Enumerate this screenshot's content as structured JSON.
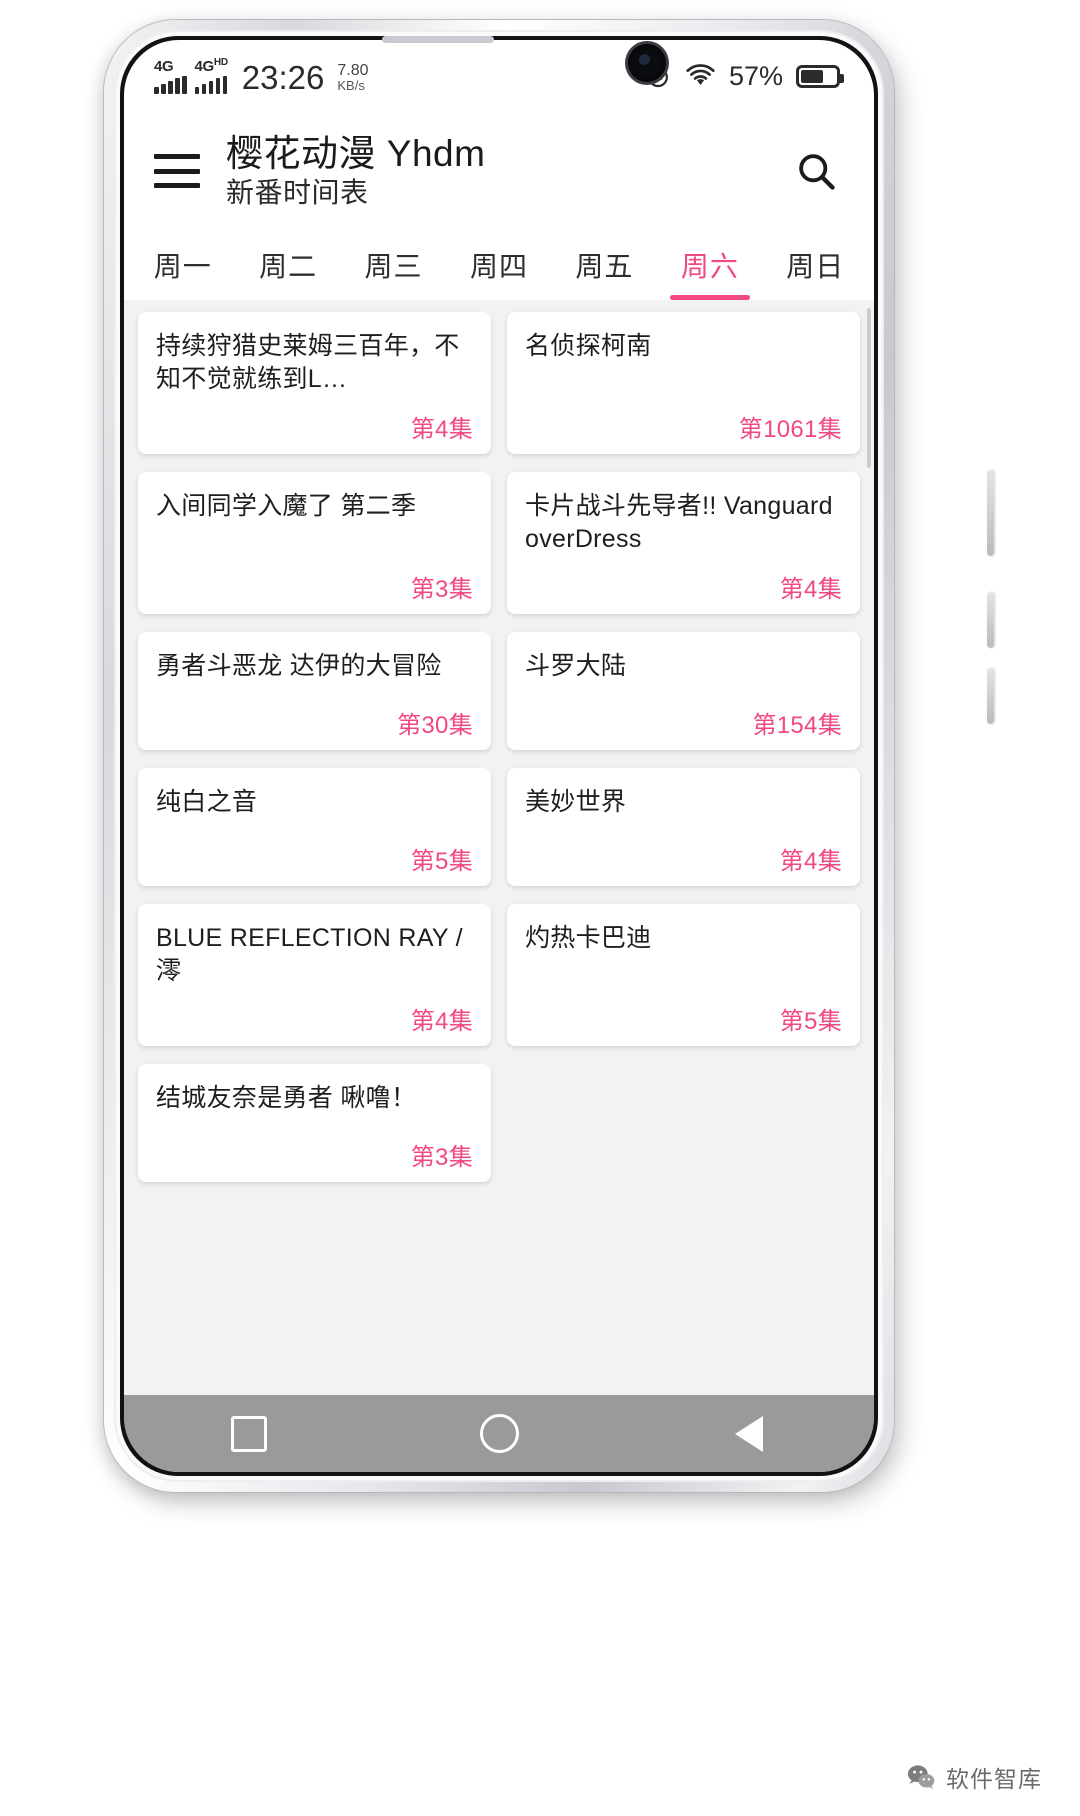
{
  "statusbar": {
    "network_label_1": "4G",
    "network_label_2": "4G",
    "network_label_2_sup": "HD",
    "time": "23:26",
    "speed_value": "7.80",
    "speed_unit": "KB/s",
    "alarm_icon": "alarm-clock-icon",
    "wifi_icon": "wifi-icon",
    "battery_percent": "57%",
    "battery_icon": "battery-icon"
  },
  "appbar": {
    "menu_icon": "hamburger-menu-icon",
    "title": "樱花动漫 Yhdm",
    "subtitle": "新番时间表",
    "search_icon": "search-icon"
  },
  "tabs": {
    "items": [
      {
        "label": "周一",
        "active": false
      },
      {
        "label": "周二",
        "active": false
      },
      {
        "label": "周三",
        "active": false
      },
      {
        "label": "周四",
        "active": false
      },
      {
        "label": "周五",
        "active": false
      },
      {
        "label": "周六",
        "active": true
      },
      {
        "label": "周日",
        "active": false
      }
    ],
    "active_color": "#f1497f"
  },
  "schedule": {
    "cards": [
      {
        "title": "持续狩猎史莱姆三百年，不知不觉就练到L…",
        "episode": "第4集"
      },
      {
        "title": "名侦探柯南",
        "episode": "第1061集"
      },
      {
        "title": "入间同学入魔了 第二季",
        "episode": "第3集"
      },
      {
        "title": "卡片战斗先导者!! Vanguard overDress",
        "episode": "第4集"
      },
      {
        "title": "勇者斗恶龙 达伊的大冒险",
        "episode": "第30集"
      },
      {
        "title": "斗罗大陆",
        "episode": "第154集"
      },
      {
        "title": "纯白之音",
        "episode": "第5集"
      },
      {
        "title": "美妙世界",
        "episode": "第4集"
      },
      {
        "title": "BLUE REFLECTION RAY / 澪",
        "episode": "第4集"
      },
      {
        "title": "灼热卡巴迪",
        "episode": "第5集"
      },
      {
        "title": "结城友奈是勇者 啾噜！",
        "episode": "第3集"
      }
    ]
  },
  "navbar": {
    "recents_icon": "square-recents-icon",
    "home_icon": "circle-home-icon",
    "back_icon": "triangle-back-icon"
  },
  "watermark": {
    "icon": "wechat-icon",
    "text": "软件智库"
  },
  "colors": {
    "accent": "#f1497f",
    "content_bg": "#f2f2f2",
    "navbar_bg": "#9a9a9a"
  }
}
